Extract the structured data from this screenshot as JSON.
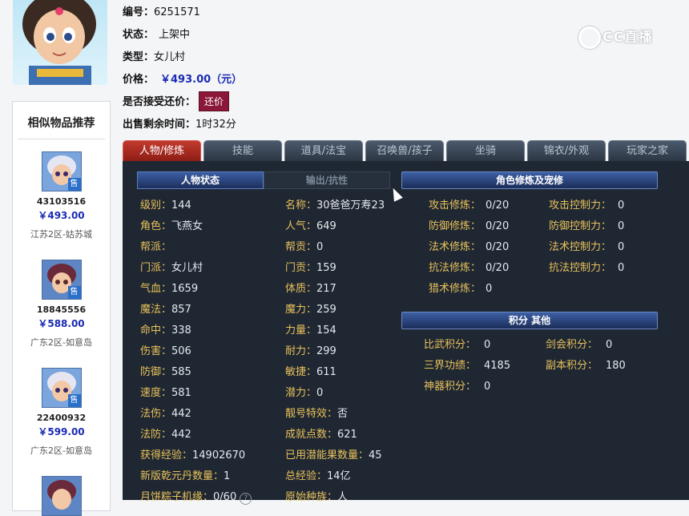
{
  "item": {
    "id_label": "编号：",
    "id_value": "6251571",
    "status_label": "状态：",
    "status_value": "上架中",
    "type_label": "类型：",
    "type_value": "女儿村",
    "price_label": "价格：",
    "price_value": "￥493.00（元）",
    "haggle_label": "是否接受还价：",
    "haggle_button": "还价",
    "time_label": "出售剩余时间：",
    "time_value": "1时32分"
  },
  "watermark": "CC直播",
  "sidebar": {
    "title": "相似物品推荐",
    "sell_badge": "售",
    "items": [
      {
        "id": "43103516",
        "price": "￥493.00",
        "server": "江苏2区-姑苏城"
      },
      {
        "id": "18845556",
        "price": "￥588.00",
        "server": "广东2区-如意岛"
      },
      {
        "id": "22400932",
        "price": "￥599.00",
        "server": "广东2区-如意岛"
      }
    ]
  },
  "tabs": [
    "人物/修炼",
    "技能",
    "道具/法宝",
    "召唤兽/孩子",
    "坐骑",
    "锦衣/外观",
    "玩家之家"
  ],
  "subtabs": {
    "active": "人物状态",
    "inactive": "输出/抗性"
  },
  "sections": {
    "cultivation_title": "角色修炼及宠修",
    "points_title": "积分  其他"
  },
  "stats_left": [
    {
      "k": "级别：",
      "v": "144"
    },
    {
      "k": "角色：",
      "v": "飞燕女"
    },
    {
      "k": "帮派：",
      "v": ""
    },
    {
      "k": "门派：",
      "v": "女儿村"
    },
    {
      "k": "气血：",
      "v": "1659"
    },
    {
      "k": "魔法：",
      "v": "857"
    },
    {
      "k": "命中：",
      "v": "338"
    },
    {
      "k": "伤害：",
      "v": "506"
    },
    {
      "k": "防御：",
      "v": "585"
    },
    {
      "k": "速度：",
      "v": "581"
    },
    {
      "k": "法伤：",
      "v": "442"
    },
    {
      "k": "法防：",
      "v": "442"
    },
    {
      "k": "获得经验：",
      "v": "14902670"
    },
    {
      "k": "新版乾元丹数量：",
      "v": "1"
    },
    {
      "k": "月饼粽子机缘：",
      "v": "0/60"
    }
  ],
  "stats_mid": [
    {
      "k": "名称：",
      "v": "30爸爸万寿23"
    },
    {
      "k": "人气：",
      "v": "649"
    },
    {
      "k": "帮贡：",
      "v": "0"
    },
    {
      "k": "门贡：",
      "v": "159"
    },
    {
      "k": "体质：",
      "v": "217"
    },
    {
      "k": "魔力：",
      "v": "259"
    },
    {
      "k": "力量：",
      "v": "154"
    },
    {
      "k": "耐力：",
      "v": "299"
    },
    {
      "k": "敏捷：",
      "v": "611"
    },
    {
      "k": "潜力：",
      "v": "0"
    },
    {
      "k": "靓号特效：",
      "v": "否"
    },
    {
      "k": "成就点数：",
      "v": "621"
    },
    {
      "k": "已用潜能果数量：",
      "v": "45"
    },
    {
      "k": "总经验：",
      "v": "14亿"
    },
    {
      "k": "原始种族：",
      "v": "人"
    }
  ],
  "cultivation_left": [
    {
      "k": "攻击修炼：",
      "v": "0/20"
    },
    {
      "k": "防御修炼：",
      "v": "0/20"
    },
    {
      "k": "法术修炼：",
      "v": "0/20"
    },
    {
      "k": "抗法修炼：",
      "v": "0/20"
    },
    {
      "k": "猎术修炼：",
      "v": "0"
    }
  ],
  "cultivation_right": [
    {
      "k": "攻击控制力：",
      "v": "0"
    },
    {
      "k": "防御控制力：",
      "v": "0"
    },
    {
      "k": "法术控制力：",
      "v": "0"
    },
    {
      "k": "抗法控制力：",
      "v": "0"
    }
  ],
  "points_left": [
    {
      "k": "比武积分：",
      "v": "0"
    },
    {
      "k": "三界功绩：",
      "v": "4185"
    },
    {
      "k": "神器积分：",
      "v": "0"
    }
  ],
  "points_right": [
    {
      "k": "剑会积分：",
      "v": "0"
    },
    {
      "k": "副本积分：",
      "v": "180"
    }
  ]
}
